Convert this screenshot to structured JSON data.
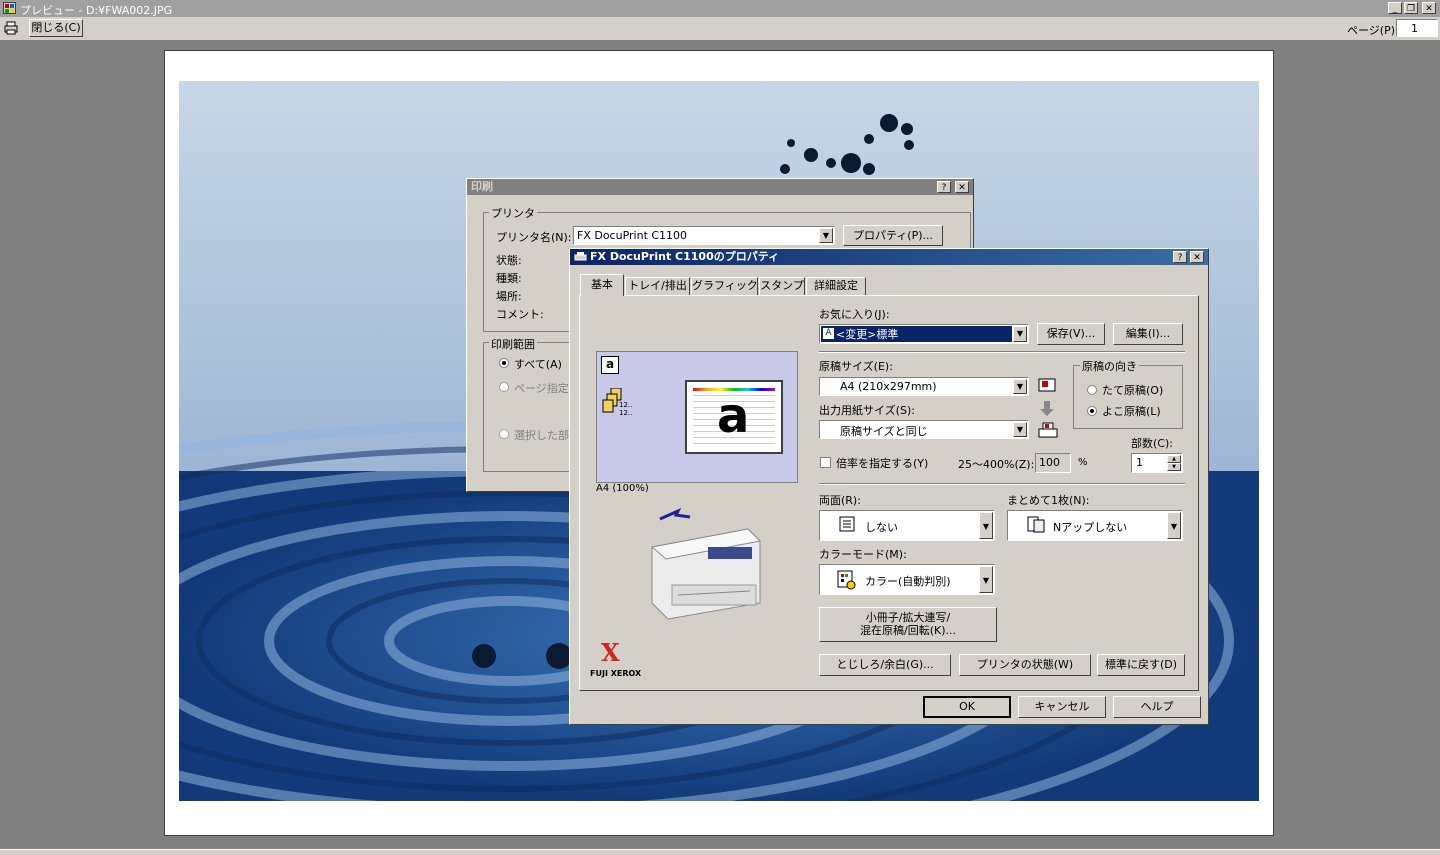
{
  "window": {
    "title": "プレビュー - D:¥FWA002.JPG",
    "page_label": "ページ(P)",
    "page_value": "1"
  },
  "toolbar": {
    "close_label": "閉じる(C)"
  },
  "print_dialog": {
    "title": "印刷",
    "printer_group": "プリンタ",
    "printer_name_label": "プリンタ名(N):",
    "printer_name_value": "FX DocuPrint C1100",
    "properties_button": "プロパティ(P)...",
    "status_label": "状態:",
    "type_label": "種類:",
    "location_label": "場所:",
    "comment_label": "コメント:",
    "range_group": "印刷範囲",
    "range_all": "すべて(A)",
    "range_pages": "ページ指定",
    "range_selection": "選択した部"
  },
  "props_dialog": {
    "title": "FX DocuPrint C1100のプロパティ",
    "tabs": [
      "基本",
      "トレイ/排出",
      "グラフィックス",
      "スタンプ",
      "詳細設定"
    ],
    "favorites_label": "お気に入り(J):",
    "favorites_value": "<変更>標準",
    "save_button": "保存(V)...",
    "edit_button": "編集(I)...",
    "paper_size_label": "原稿サイズ(E):",
    "paper_size_value": "A4 (210x297mm)",
    "output_size_label": "出力用紙サイズ(S):",
    "output_size_value": "原稿サイズと同じ",
    "orientation_group": "原稿の向き",
    "orient_portrait": "たて原稿(O)",
    "orient_landscape": "よこ原稿(L)",
    "scale_check": "倍率を指定する(Y)",
    "scale_range": "25～400%(Z):",
    "scale_value": "100",
    "scale_unit": "%",
    "copies_label": "部数(C):",
    "copies_value": "1",
    "duplex_label": "両面(R):",
    "duplex_value": "しない",
    "nup_label": "まとめて1枚(N):",
    "nup_value": "Nアップしない",
    "color_label": "カラーモード(M):",
    "color_value": "カラー(自動判別)",
    "booklet_button_line1": "小冊子/拡大連写/",
    "booklet_button_line2": "混在原稿/回転(K)...",
    "binding_button": "とじしろ/余白(G)...",
    "printer_status_button": "プリンタの状態(W)",
    "defaults_button": "標準に戻す(D)",
    "preview_caption": "A4 (100%)",
    "preview_big_letter": "a",
    "preview_small_letter": "a",
    "preview_page_numbers": [
      "12..",
      "12.."
    ],
    "brand_x": "X",
    "brand_name": "FUJI XEROX",
    "ok_button": "OK",
    "cancel_button": "キャンセル",
    "help_button": "ヘルプ"
  },
  "colors": {
    "active_title": "#0a246a",
    "inactive_title": "#808080",
    "dialog_bg": "#d4d0c8",
    "xerox_red": "#d42020",
    "selection": "#0a246a"
  }
}
